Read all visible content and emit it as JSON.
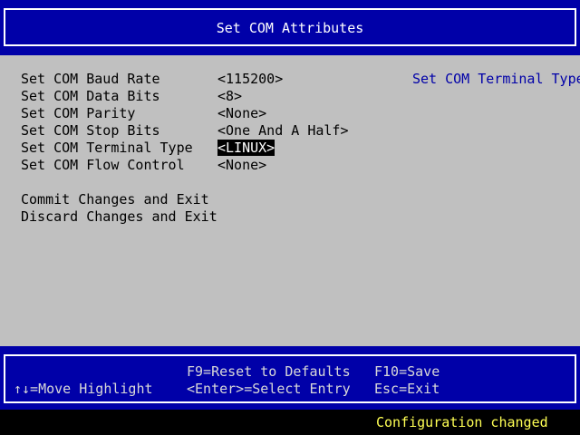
{
  "header": {
    "title": "Set COM Attributes"
  },
  "settings": [
    {
      "label": "Set COM Baud Rate",
      "value": "<115200>"
    },
    {
      "label": "Set COM Data Bits",
      "value": "<8>"
    },
    {
      "label": "Set COM Parity",
      "value": "<None>"
    },
    {
      "label": "Set COM Stop Bits",
      "value": "<One And A Half>"
    },
    {
      "label": "Set COM Terminal Type",
      "value": "<LINUX>"
    },
    {
      "label": "Set COM Flow Control",
      "value": "<None>"
    }
  ],
  "actions": {
    "commit": "Commit Changes and Exit",
    "discard": "Discard Changes and Exit"
  },
  "help": {
    "text": "Set COM Terminal Type"
  },
  "footer": {
    "move": "↑↓=Move Highlight",
    "reset": "F9=Reset to Defaults",
    "select": "<Enter>=Select Entry",
    "save": "F10=Save",
    "exit": "Esc=Exit"
  },
  "status": {
    "message": "Configuration changed"
  },
  "colors": {
    "background": "#c0c0c0",
    "frame": "#0000a8",
    "help_text": "#0000a8",
    "status_text": "#ffff54"
  }
}
